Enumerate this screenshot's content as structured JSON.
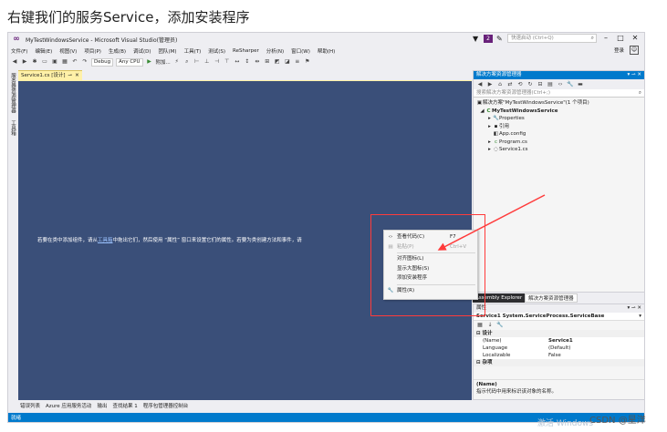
{
  "page": {
    "heading": "右键我们的服务Service，添加安装程序"
  },
  "window": {
    "title": "MyTestWindowsService - Microsoft Visual Studio(管理员)",
    "notify_count": "2",
    "quick_launch_placeholder": "快速启动 (Ctrl+Q)",
    "minimize": "–",
    "maximize": "□",
    "close": "✕",
    "sign_in": "登录"
  },
  "menu": {
    "items": [
      "文件(F)",
      "编辑(E)",
      "视图(V)",
      "项目(P)",
      "生成(B)",
      "调试(D)",
      "团队(M)",
      "工具(T)",
      "测试(S)",
      "ReSharper",
      "分析(N)",
      "窗口(W)",
      "帮助(H)"
    ]
  },
  "toolbar": {
    "config": "Debug",
    "platform": "Any CPU",
    "start_label": "附加..."
  },
  "left_strip": {
    "tabs": [
      "服务器资源管理器",
      "工具箱"
    ]
  },
  "document": {
    "tab_label": "Service1.cs [设计]",
    "hint_before": "若要在类中添加组件，请从",
    "hint_link": "工具箱",
    "hint_after": "中拖出它们，然后使用 “属性” 窗口来设置它们的属性。若要为类创建方法和事件，请"
  },
  "bottom_tabs": [
    "错误列表",
    "Azure 应用服务活动",
    "输出",
    "查找结果 1",
    "程序包管理器控制台"
  ],
  "status": {
    "text": "就绪"
  },
  "solution_explorer": {
    "title": "解决方案资源管理器",
    "search_placeholder": "搜索解决方案资源管理器(Ctrl+;)",
    "tree": [
      {
        "label": "解决方案\"MyTestWindowsService\"(1 个项目)",
        "icon": "▣",
        "indent": 0,
        "bold": false
      },
      {
        "label": "MyTestWindowsService",
        "icon": "C#",
        "indent": 1,
        "bold": true
      },
      {
        "label": "Properties",
        "icon": "▸",
        "indent": 2,
        "bold": false
      },
      {
        "label": "引用",
        "icon": "▸",
        "indent": 2,
        "bold": false
      },
      {
        "label": "App.config",
        "icon": "◧",
        "indent": 2,
        "bold": false
      },
      {
        "label": "Program.cs",
        "icon": "▸",
        "indent": 2,
        "bold": false
      },
      {
        "label": "Service1.cs",
        "icon": "▸",
        "indent": 2,
        "bold": false
      }
    ],
    "tabs": [
      "Assembly Explorer",
      "解决方案资源管理器"
    ]
  },
  "properties": {
    "title": "属性",
    "object": "Service1  System.ServiceProcess.ServiceBase",
    "cat_design": "设计",
    "rows": [
      {
        "name": "(Name)",
        "value": "Service1"
      },
      {
        "name": "Language",
        "value": "(Default)"
      },
      {
        "name": "Localizable",
        "value": "False"
      }
    ],
    "cat_misc": "杂项",
    "desc_title": "(Name)",
    "desc_text": "指示代码中用来标识该对象的名称。"
  },
  "context_menu": {
    "items": [
      {
        "label": "查看代码(C)",
        "key": "F7",
        "icon": "<>",
        "disabled": false
      },
      {
        "label": "粘贴(P)",
        "key": "Ctrl+V",
        "icon": "▤",
        "disabled": true
      },
      {
        "label": "对齐图标(L)",
        "key": "",
        "icon": "",
        "disabled": false
      },
      {
        "label": "显示大图标(S)",
        "key": "",
        "icon": "",
        "disabled": false
      },
      {
        "label": "添加安装程序",
        "key": "",
        "icon": "",
        "disabled": false
      },
      {
        "label": "属性(R)",
        "key": "",
        "icon": "🔧",
        "disabled": false
      }
    ]
  },
  "overlay": {
    "watermark": "激活 Windows",
    "credit": "CSDN @星洋"
  },
  "colors": {
    "accent": "#007acc",
    "designer": "#3a4f79",
    "highlight": "#ff3b3b",
    "tab_active": "#fff1a8"
  }
}
